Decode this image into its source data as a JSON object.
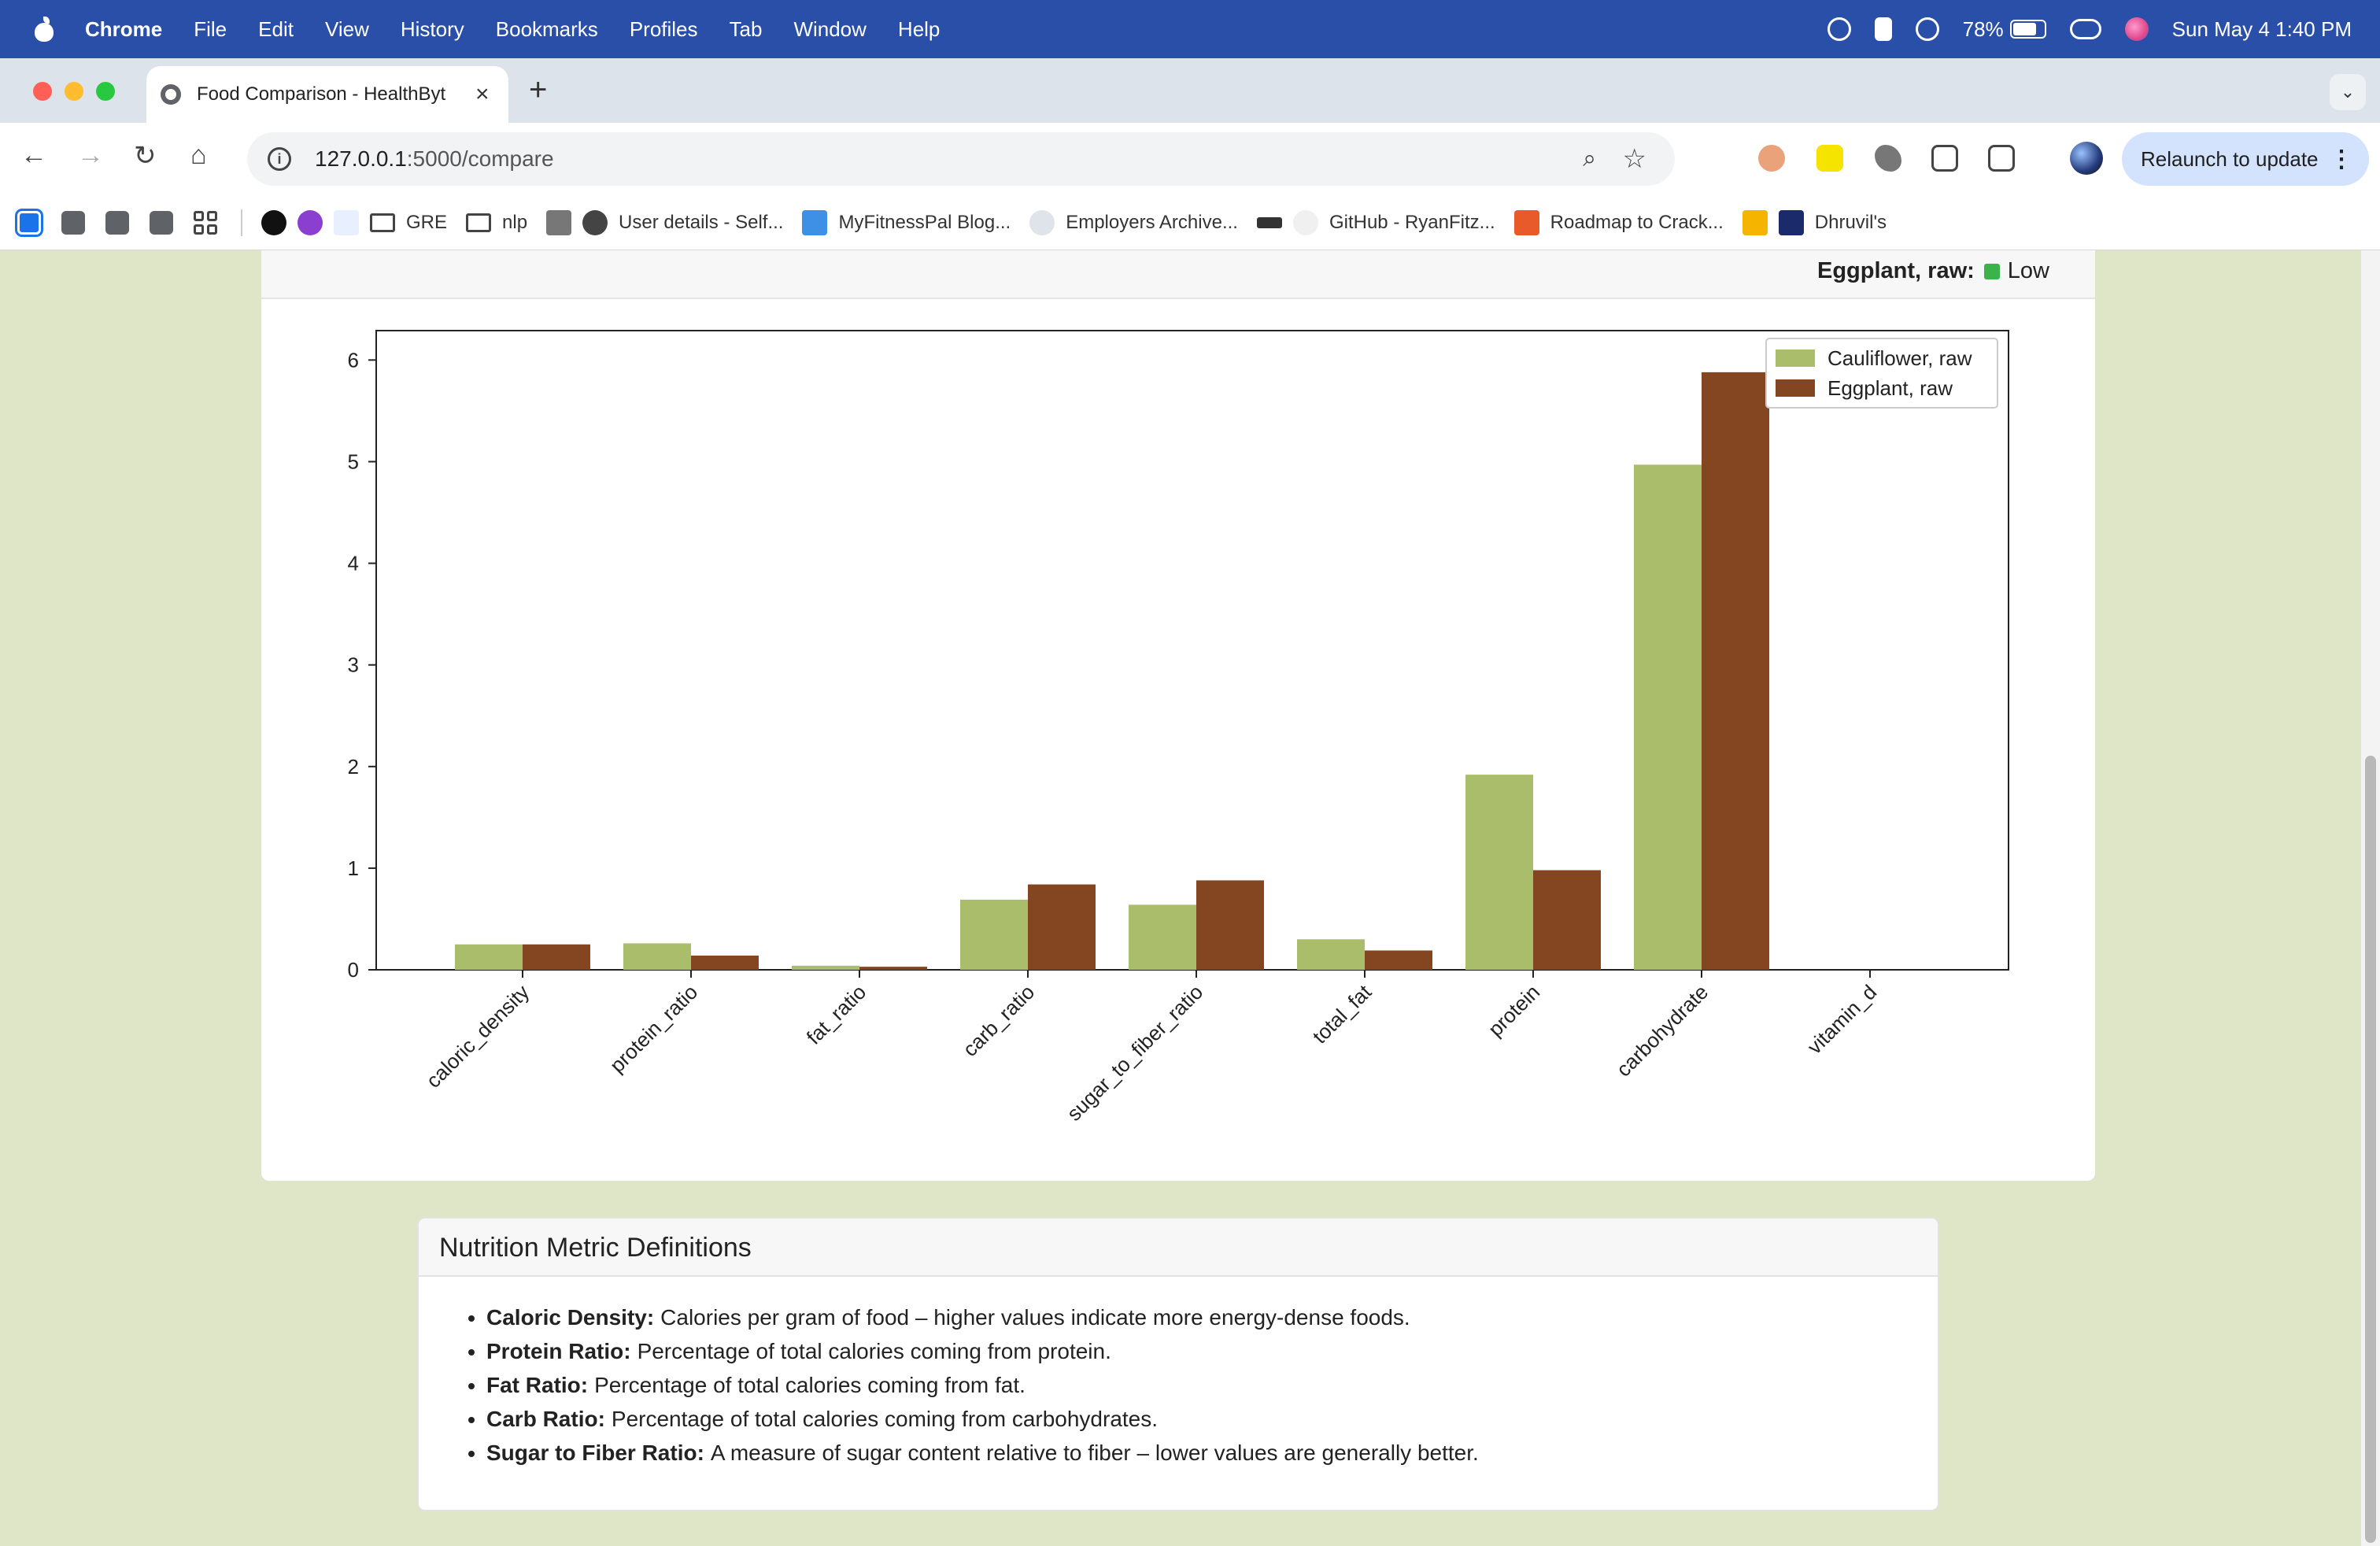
{
  "menubar": {
    "app": "Chrome",
    "items": [
      "File",
      "Edit",
      "View",
      "History",
      "Bookmarks",
      "Profiles",
      "Tab",
      "Window",
      "Help"
    ],
    "battery": "78%",
    "battery_level": 0.78,
    "datetime": "Sun May 4  1:40 PM"
  },
  "tab": {
    "title": "Food Comparison - HealthByt",
    "close": "×",
    "new": "+"
  },
  "toolbar": {
    "url_host": "127.0.0.1",
    "url_rest": ":5000/compare",
    "relaunch_label": "Relaunch to update"
  },
  "bookmarks": [
    {
      "label": "GRE",
      "kind": "folder"
    },
    {
      "label": "nlp",
      "kind": "folder"
    },
    {
      "label": "User details - Self...",
      "kind": "globe"
    },
    {
      "label": "MyFitnessPal Blog...",
      "kind": "mfp"
    },
    {
      "label": "Employers Archive...",
      "kind": "fa"
    },
    {
      "label": "GitHub - RyanFitz...",
      "kind": "github"
    },
    {
      "label": "Roadmap to Crack...",
      "kind": "roadmap"
    },
    {
      "label": "Dhruvil's",
      "kind": "dj"
    }
  ],
  "chart_header": {
    "food": "Eggplant, raw:",
    "level": "Low",
    "level_color": "#3cb34a"
  },
  "chart_data": {
    "type": "bar",
    "categories": [
      "caloric_density",
      "protein_ratio",
      "fat_ratio",
      "carb_ratio",
      "sugar_to_fiber_ratio",
      "total_fat",
      "protein",
      "carbohydrate",
      "vitamin_d"
    ],
    "series": [
      {
        "name": "Cauliflower, raw",
        "color": "#a9bd6a",
        "values": [
          0.25,
          0.26,
          0.04,
          0.69,
          0.64,
          0.3,
          1.92,
          4.97,
          0
        ]
      },
      {
        "name": "Eggplant, raw",
        "color": "#834620",
        "values": [
          0.25,
          0.14,
          0.03,
          0.84,
          0.88,
          0.19,
          0.98,
          5.88,
          0
        ]
      }
    ],
    "yticks": [
      0,
      1,
      2,
      3,
      4,
      5,
      6
    ],
    "ylim": [
      0,
      6.15
    ],
    "legend_position": "top-right"
  },
  "definitions": {
    "title": "Nutrition Metric Definitions",
    "items": [
      {
        "term": "Caloric Density:",
        "desc": "Calories per gram of food – higher values indicate more energy-dense foods."
      },
      {
        "term": "Protein Ratio:",
        "desc": "Percentage of total calories coming from protein."
      },
      {
        "term": "Fat Ratio:",
        "desc": "Percentage of total calories coming from fat."
      },
      {
        "term": "Carb Ratio:",
        "desc": "Percentage of total calories coming from carbohydrates."
      },
      {
        "term": "Sugar to Fiber Ratio:",
        "desc": "A measure of sugar content relative to fiber – lower values are generally better."
      }
    ]
  }
}
